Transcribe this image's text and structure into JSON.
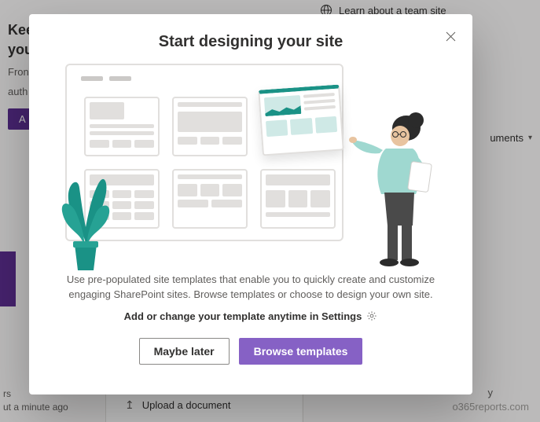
{
  "background": {
    "heading_line1": "Kee",
    "heading_line2": "you",
    "subline1": "Fron",
    "subline2": "auth",
    "button_label": "A",
    "top_link": "Learn about a team site",
    "documents_label": "uments",
    "minute_line1": "rs",
    "minute_line2": "ut a minute ago",
    "upload_label": "Upload a document",
    "y_char": "y"
  },
  "modal": {
    "title": "Start designing your site",
    "desc_line1": "Use pre-populated site templates that enable you to quickly create and customize",
    "desc_line2": "engaging SharePoint sites. Browse templates or choose to design your own site.",
    "note": "Add or change your template anytime in Settings",
    "secondary_label": "Maybe later",
    "primary_label": "Browse templates"
  },
  "watermark": "o365reports.com"
}
